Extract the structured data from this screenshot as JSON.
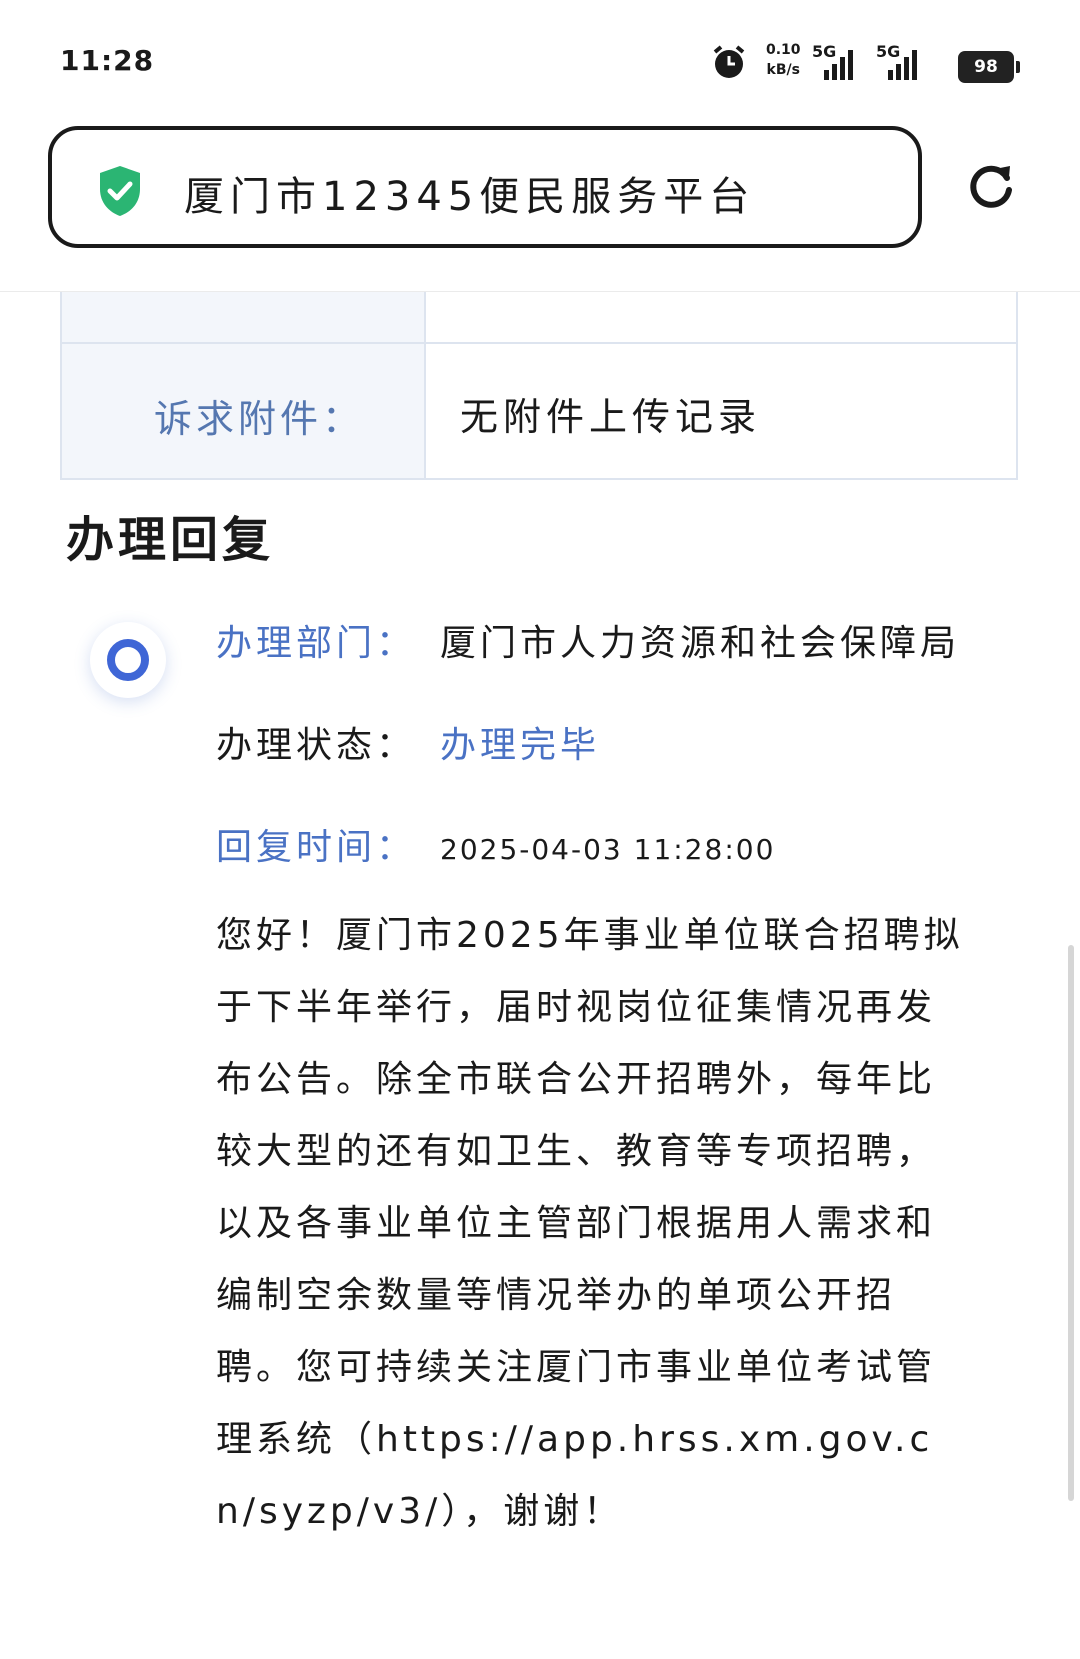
{
  "status_bar": {
    "time": "11:28",
    "net_speed_value": "0.10",
    "net_speed_unit": "kB/s",
    "network_1": "5G",
    "network_2": "5G",
    "battery": "98",
    "icons": [
      "alarm-icon",
      "signal-icon",
      "battery-icon"
    ]
  },
  "address_bar": {
    "title": "厦门市12345便民服务平台",
    "secure_icon": "shield-check-icon",
    "reload_icon": "reload-icon",
    "accent_color": "#2bb573"
  },
  "attachment": {
    "label": "诉求附件：",
    "value": "无附件上传记录"
  },
  "section": {
    "title": "办理回复"
  },
  "reply": {
    "dept_label": "办理部门：",
    "dept_value": "厦门市人力资源和社会保障局",
    "status_label": "办理状态：",
    "status_value": "办理完毕",
    "time_label": "回复时间：",
    "time_value": "2025-04-03 11:28:00",
    "content": "您好！厦门市2025年事业单位联合招聘拟于下半年举行，届时视岗位征集情况再发布公告。除全市联合公开招聘外，每年比较大型的还有如卫生、教育等专项招聘，以及各事业单位主管部门根据用人需求和编制空余数量等情况举办的单项公开招聘。您可持续关注厦门市事业单位考试管理系统（https://app.hrss.xm.gov.cn/syzp/v3/），谢谢！",
    "accent_color": "#4a72c4"
  }
}
